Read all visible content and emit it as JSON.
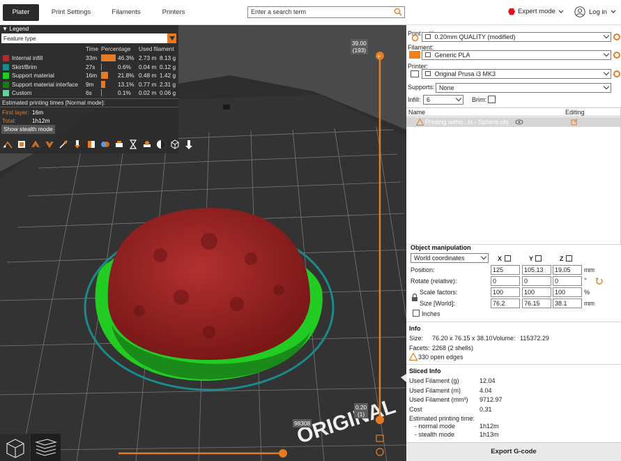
{
  "tabs": [
    "Plater",
    "Print Settings",
    "Filaments",
    "Printers"
  ],
  "search": {
    "placeholder": "Enter a search term"
  },
  "mode_label": "Expert mode",
  "login_label": "Log in",
  "legend": {
    "title": "Legend",
    "view_type": "Feature type",
    "col_time": "Time",
    "col_percentage": "Percentage",
    "col_used_filament": "Used filament",
    "rows": [
      {
        "name": "Internal infill",
        "time": "33m",
        "percent": "46.3%",
        "meters": "2.73 m",
        "grams": "8.13 g",
        "color": "#b22a2a",
        "fraction": 0.463
      },
      {
        "name": "Skirt/Brim",
        "time": "27s",
        "percent": "0.6%",
        "meters": "0.04 m",
        "grams": "0.12 g",
        "color": "#1a8a8a",
        "fraction": 0.006
      },
      {
        "name": "Support material",
        "time": "16m",
        "percent": "21.8%",
        "meters": "0.48 m",
        "grams": "1.42 g",
        "color": "#22cc22",
        "fraction": 0.218
      },
      {
        "name": "Support material interface",
        "time": "9m",
        "percent": "13.1%",
        "meters": "0.77 m",
        "grams": "2.31 g",
        "color": "#1a7a1a",
        "fraction": 0.131
      },
      {
        "name": "Custom",
        "time": "6s",
        "percent": "0.1%",
        "meters": "0.02 m",
        "grams": "0.06 g",
        "color": "#5fd39a",
        "fraction": 0.001
      }
    ],
    "estimated_heading": "Estimated printing times [Normal mode]:",
    "first_layer_label": "First layer:",
    "first_layer_value": "16m",
    "total_label": "Total:",
    "total_value": "1h12m",
    "stealth_button": "Show stealth mode"
  },
  "vertical_slider": {
    "top_value": "39.00",
    "top_layer": "(193)",
    "bottom_value": "0.20",
    "bottom_layer": "(1)"
  },
  "horizontal_slider": {
    "value": "98308"
  },
  "bed_text": "ORIGINAL",
  "print_settings": {
    "label": "Print settings:",
    "value": "0.20mm QUALITY (modified)"
  },
  "filament": {
    "label": "Filament:",
    "value": "Generic PLA",
    "color": "#f07f1a"
  },
  "printer": {
    "label": "Printer:",
    "value": "Original Prusa i3 MK3"
  },
  "supports": {
    "label": "Supports:",
    "value": "None"
  },
  "infill": {
    "label": "Infill:",
    "value": "6"
  },
  "brim": {
    "label": "Brim:"
  },
  "object_list": {
    "col_name": "Name",
    "col_editing": "Editing",
    "items": [
      {
        "name": "Printing witho...ls - Sphere.obj"
      }
    ]
  },
  "object_manipulation": {
    "title": "Object manipulation",
    "coord_system": "World coordinates",
    "axis_x": "X",
    "axis_y": "Y",
    "axis_z": "Z",
    "position_label": "Position:",
    "position": [
      "125",
      "105.13",
      "19.05"
    ],
    "position_unit": "mm",
    "rotate_label": "Rotate (relative):",
    "rotate": [
      "0",
      "0",
      "0"
    ],
    "rotate_unit": "°",
    "scale_label": "Scale factors:",
    "scale": [
      "100",
      "100",
      "100"
    ],
    "scale_unit": "%",
    "size_label": "Size [World]:",
    "size": [
      "76.2",
      "76.15",
      "38.1"
    ],
    "size_unit": "mm",
    "inches_label": "Inches"
  },
  "info": {
    "title": "Info",
    "size_label": "Size:",
    "size_value": "76.20 x 76.15 x 38.10",
    "volume_label": "Volume:",
    "volume_value": "115372.29",
    "facets_label": "Facets:",
    "facets_value": "2268 (2 shells)",
    "warning": "330 open edges"
  },
  "sliced_info": {
    "title": "Sliced Info",
    "rows": [
      {
        "label": "Used Filament (g)",
        "value": "12.04"
      },
      {
        "label": "Used Filament (m)",
        "value": "4.04"
      },
      {
        "label": "Used Filament (mm³)",
        "value": "9712.97"
      },
      {
        "label": "Cost",
        "value": "0.31"
      }
    ],
    "estimated_label": "Estimated printing time:",
    "normal_label": "- normal mode",
    "normal_value": "1h12m",
    "stealth_label": "- stealth mode",
    "stealth_value": "1h13m"
  },
  "export_button": "Export G-code",
  "colors": {
    "accent": "#e57c24",
    "infill": "#a52626",
    "support": "#22cc22",
    "bed": "#2f2f2f"
  }
}
